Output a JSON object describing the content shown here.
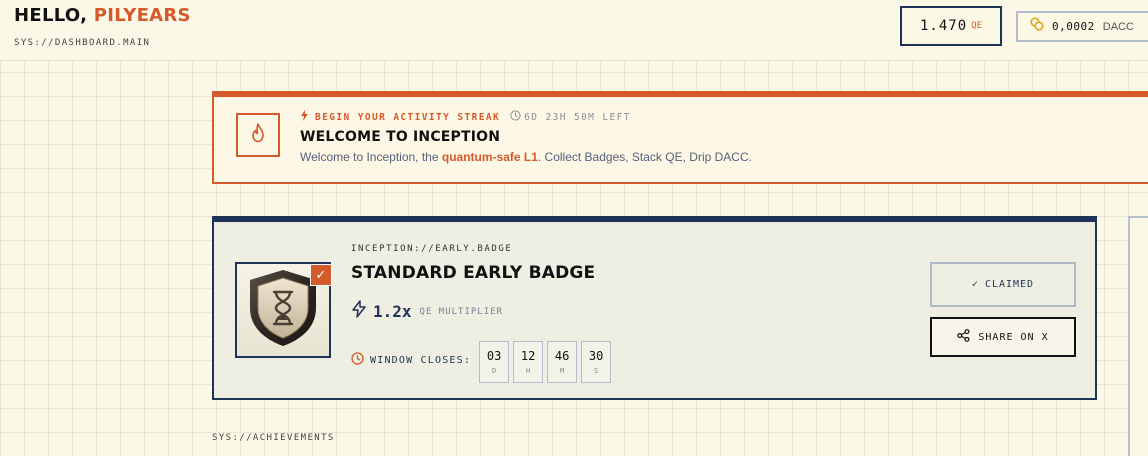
{
  "header": {
    "greeting": "HELLO,",
    "username": "PILYEARS",
    "sys_path": "SYS://DASHBOARD.MAIN",
    "qe_balance": "1.470",
    "qe_unit": "QE",
    "dacc_icon": "coins-icon",
    "dacc_balance": "0,0002",
    "dacc_unit": "DACC"
  },
  "streak": {
    "icon": "flame-icon",
    "label": "BEGIN YOUR ACTIVITY STREAK",
    "time_left": "6D 23H 50M LEFT",
    "title": "WELCOME TO INCEPTION",
    "desc_prefix": "Welcome to Inception, the ",
    "desc_highlight": "quantum-safe L1",
    "desc_suffix": ". Collect Badges, Stack QE, Drip DACC."
  },
  "badge": {
    "path": "INCEPTION://EARLY.BADGE",
    "title": "STANDARD EARLY BADGE",
    "multiplier": "1.2x",
    "multiplier_label": "QE MULTIPLIER",
    "window_label": "WINDOW CLOSES:",
    "countdown": [
      {
        "value": "03",
        "unit": "D"
      },
      {
        "value": "12",
        "unit": "H"
      },
      {
        "value": "46",
        "unit": "M"
      },
      {
        "value": "30",
        "unit": "S"
      }
    ],
    "claimed_label": "CLAIMED",
    "share_label": "SHARE ON X"
  },
  "achievements": {
    "sys_path": "SYS://ACHIEVEMENTS"
  },
  "colors": {
    "accent": "#d45a2c",
    "navy": "#1f3359",
    "background": "#fbf8e6"
  }
}
